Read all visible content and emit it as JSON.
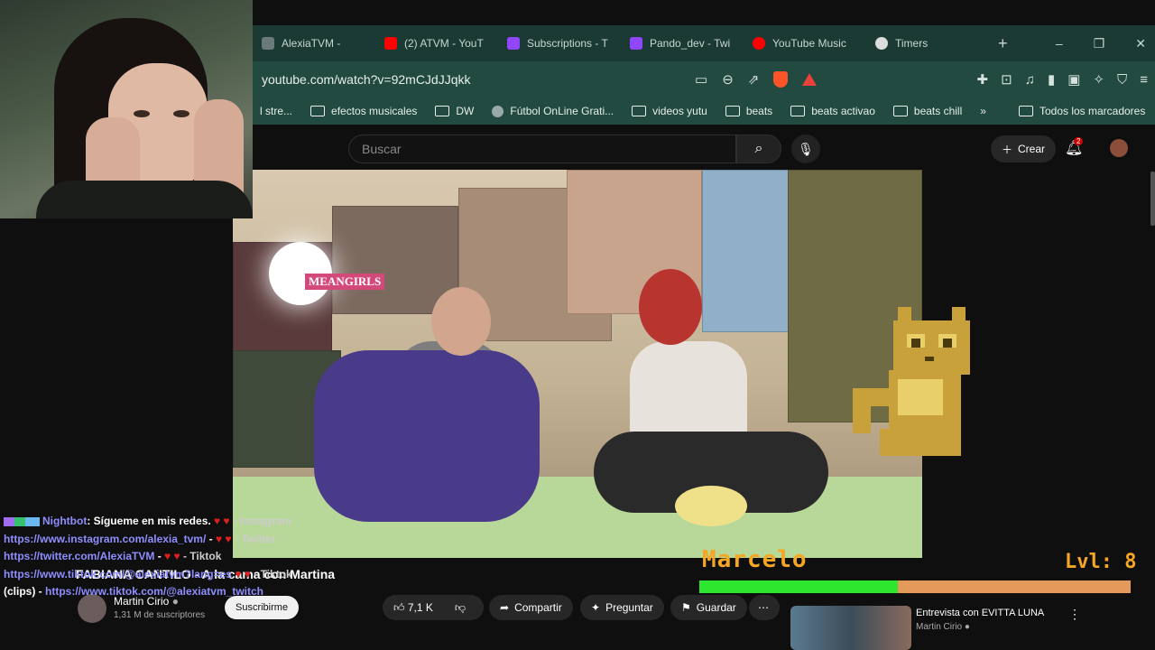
{
  "browser": {
    "tabs": [
      {
        "label": "AlexiaTVM -",
        "icon": "mute-icon",
        "color": "#9aa"
      },
      {
        "label": "(2) ATVM - YouT",
        "icon": "youtube-icon",
        "color": "#ff0000"
      },
      {
        "label": "Subscriptions - T",
        "icon": "twitch-icon",
        "color": "#9146ff"
      },
      {
        "label": "Pando_dev - Twi",
        "icon": "twitch-icon",
        "color": "#9146ff"
      },
      {
        "label": "YouTube Music",
        "icon": "youtube-music-icon",
        "color": "#ff0000"
      },
      {
        "label": "Timers",
        "icon": "timer-icon",
        "color": "#ddd"
      }
    ],
    "url": "youtube.com/watch?v=92mCJdJJqkk",
    "bookmarks": [
      {
        "label": "l stre...",
        "type": "folder"
      },
      {
        "label": "efectos musicales",
        "type": "folder"
      },
      {
        "label": "DW",
        "type": "folder"
      },
      {
        "label": "Fútbol OnLine Grati...",
        "type": "site"
      },
      {
        "label": "videos yutu",
        "type": "folder"
      },
      {
        "label": "beats",
        "type": "folder"
      },
      {
        "label": "beats activao",
        "type": "folder"
      },
      {
        "label": "beats chill",
        "type": "folder"
      }
    ],
    "bookmarks_more": "»",
    "all_bookmarks": "Todos los marcadores"
  },
  "youtube": {
    "search_placeholder": "Buscar",
    "create_label": "Crear",
    "notifications_count": "2",
    "video_title": "FABIANA CANTILO - A la cama con Martina",
    "channel_name": "Martin Cirio",
    "subscribers": "1,31 M de suscriptores",
    "subscribe_label": "Suscribirme",
    "like_count": "7,1 K",
    "share_label": "Compartir",
    "ask_label": "Preguntar",
    "save_label": "Guardar",
    "recommended": {
      "title": "Entrevista con EVITTA LUNA",
      "channel": "Martin Cirio"
    }
  },
  "video_scene": {
    "poster_text": "MEANGIRLS"
  },
  "chat": {
    "messages": [
      {
        "user": "Nightbot",
        "text": ": Sígueme en mis redes.",
        "tail": " - Instagram"
      },
      {
        "link": "https://www.instagram.com/alexia_tvm/",
        "tail": " - Twitter"
      },
      {
        "link": "https://twitter.com/AlexiaTVM",
        "tail": " - Tiktok"
      },
      {
        "link": "https://www.tiktok.com/@alexiatvm?lang=es",
        "tail": " - Tiktok"
      },
      {
        "prefix": "(clips) - ",
        "link": "https://www.tiktok.com/@alexiatvm_twitch"
      }
    ]
  },
  "overlay": {
    "xp_user": "Marcelo",
    "xp_level": "Lvl: 8",
    "xp_progress": 0.46,
    "colors": {
      "xp_text": "#f5a623",
      "xp_fill": "#2ee62e",
      "xp_track": "#e49a5a"
    }
  }
}
